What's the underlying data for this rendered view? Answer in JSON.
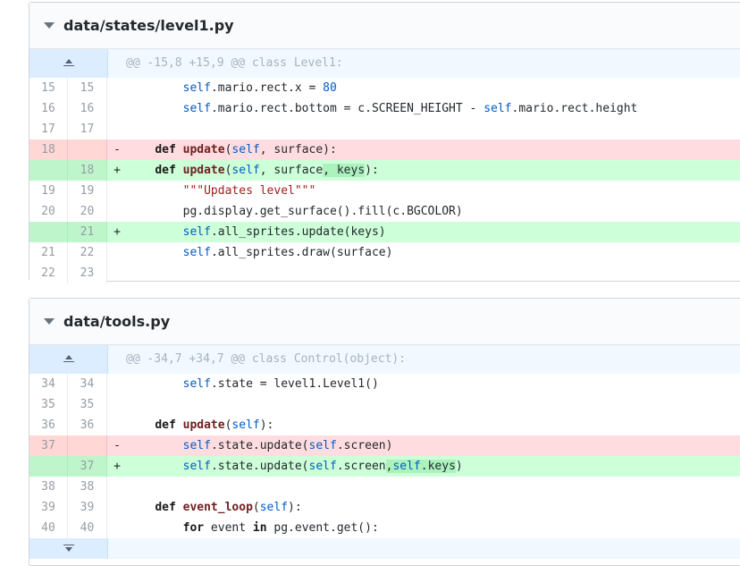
{
  "files": [
    {
      "name": "data/states/level1.py",
      "hunk": "@@ -15,8 +15,9 @@ class Level1:",
      "lines": [
        {
          "old": "15",
          "new": "15",
          "type": "ctx",
          "sign": "",
          "code": "        self.mario.rect.x = 80"
        },
        {
          "old": "16",
          "new": "16",
          "type": "ctx",
          "sign": "",
          "code": "        self.mario.rect.bottom = c.SCREEN_HEIGHT - self.mario.rect.height"
        },
        {
          "old": "17",
          "new": "17",
          "type": "ctx",
          "sign": "",
          "code": ""
        },
        {
          "old": "18",
          "new": "",
          "type": "del",
          "sign": "-",
          "code": "    def update(self, surface):"
        },
        {
          "old": "",
          "new": "18",
          "type": "add",
          "sign": "+",
          "code": "    def update(self, surface, keys):"
        },
        {
          "old": "19",
          "new": "19",
          "type": "ctx",
          "sign": "",
          "code": "        \"\"\"Updates level\"\"\""
        },
        {
          "old": "20",
          "new": "20",
          "type": "ctx",
          "sign": "",
          "code": "        pg.display.get_surface().fill(c.BGCOLOR)"
        },
        {
          "old": "",
          "new": "21",
          "type": "add",
          "sign": "+",
          "code": "        self.all_sprites.update(keys)"
        },
        {
          "old": "21",
          "new": "22",
          "type": "ctx",
          "sign": "",
          "code": "        self.all_sprites.draw(surface)"
        },
        {
          "old": "22",
          "new": "23",
          "type": "ctx",
          "sign": "",
          "code": ""
        }
      ]
    },
    {
      "name": "data/tools.py",
      "hunk": "@@ -34,7 +34,7 @@ class Control(object):",
      "lines": [
        {
          "old": "34",
          "new": "34",
          "type": "ctx",
          "sign": "",
          "code": "        self.state = level1.Level1()"
        },
        {
          "old": "35",
          "new": "35",
          "type": "ctx",
          "sign": "",
          "code": ""
        },
        {
          "old": "36",
          "new": "36",
          "type": "ctx",
          "sign": "",
          "code": "    def update(self):"
        },
        {
          "old": "37",
          "new": "",
          "type": "del",
          "sign": "-",
          "code": "        self.state.update(self.screen)"
        },
        {
          "old": "",
          "new": "37",
          "type": "add",
          "sign": "+",
          "code": "        self.state.update(self.screen,self.keys)"
        },
        {
          "old": "38",
          "new": "38",
          "type": "ctx",
          "sign": "",
          "code": ""
        },
        {
          "old": "39",
          "new": "39",
          "type": "ctx",
          "sign": "",
          "code": "    def event_loop(self):"
        },
        {
          "old": "40",
          "new": "40",
          "type": "ctx",
          "sign": "",
          "code": "        for event in pg.event.get():"
        }
      ]
    }
  ]
}
